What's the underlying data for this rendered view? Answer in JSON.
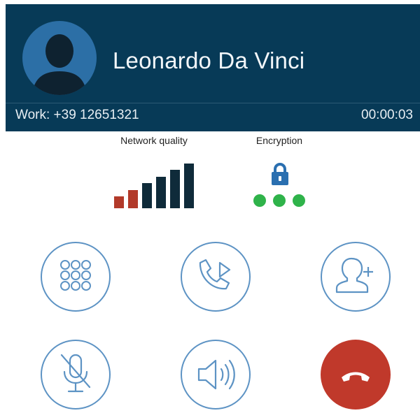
{
  "call": {
    "caller_name": "Leonardo Da Vinci",
    "number_label": "Work: +39 12651321",
    "duration": "00:00:03"
  },
  "status": {
    "network_label": "Network quality",
    "encryption_label": "Encryption",
    "signal_bars_total": 6,
    "signal_bars_weak": 2,
    "encryption_dots": 3
  },
  "colors": {
    "header_bg": "#073a57",
    "signal_weak": "#b23a2a",
    "signal_strong": "#0f2b3a",
    "lock": "#2a6fb0",
    "encryption_ok": "#2fb34a",
    "control_stroke": "#5d93c4",
    "end_call": "#c0392b"
  },
  "controls": [
    {
      "name": "keypad",
      "icon": "keypad-icon"
    },
    {
      "name": "transfer",
      "icon": "phone-forward-icon"
    },
    {
      "name": "add-participant",
      "icon": "add-contact-icon"
    },
    {
      "name": "mute",
      "icon": "mic-muted-icon"
    },
    {
      "name": "speaker",
      "icon": "speaker-icon"
    },
    {
      "name": "end-call",
      "icon": "hang-up-icon"
    }
  ]
}
